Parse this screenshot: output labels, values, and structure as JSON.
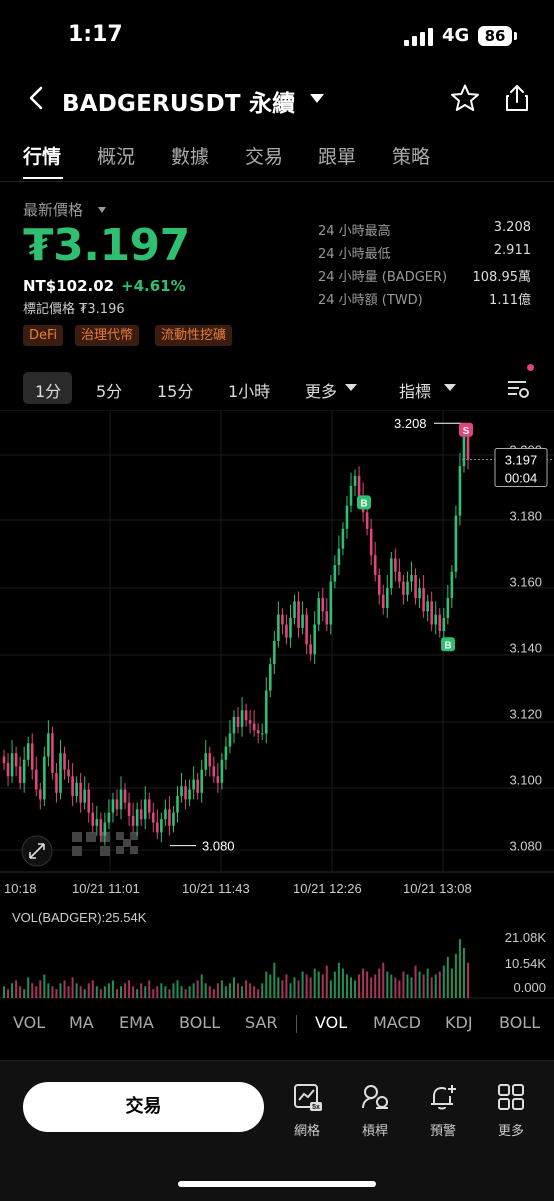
{
  "status_bar": {
    "time": "1:17",
    "network": "4G",
    "battery": "86"
  },
  "header": {
    "title": "BADGERUSDT 永續"
  },
  "tabs": [
    {
      "label": "行情",
      "active": true
    },
    {
      "label": "概況",
      "active": false
    },
    {
      "label": "數據",
      "active": false
    },
    {
      "label": "交易",
      "active": false
    },
    {
      "label": "跟單",
      "active": false
    },
    {
      "label": "策略",
      "active": false
    }
  ],
  "price": {
    "label": "最新價格",
    "last": "₮3.197",
    "fiat": "NT$102.02",
    "change": "+4.61%",
    "mark": "標記價格 ₮3.196"
  },
  "tags": [
    "DeFi",
    "治理代幣",
    "流動性挖礦"
  ],
  "stats": [
    {
      "label": "24 小時最高",
      "value": "3.208"
    },
    {
      "label": "24 小時最低",
      "value": "2.911"
    },
    {
      "label": "24 小時量 (BADGER)",
      "value": "108.95萬"
    },
    {
      "label": "24 小時額 (TWD)",
      "value": "1.11億"
    }
  ],
  "intervals": [
    "1分",
    "5分",
    "15分",
    "1小時",
    "更多",
    "指標"
  ],
  "colors": {
    "up": "#2fbf71",
    "down": "#e0457b",
    "accent_tag_bg": "#3a1d10",
    "accent_tag_fg": "#e87c3e"
  },
  "chart_data": {
    "type": "candlestick",
    "y_ticks": [
      "3.200",
      "3.180",
      "3.160",
      "3.140",
      "3.120",
      "3.100",
      "3.080"
    ],
    "ylim": [
      3.072,
      3.212
    ],
    "x_ticks": [
      "10:18",
      "10/21 11:01",
      "10/21 11:43",
      "10/21 12:26",
      "10/21 13:08"
    ],
    "high_label": "3.208",
    "low_label": "3.080",
    "current_price": "3.197",
    "countdown": "00:04",
    "markers": [
      {
        "label": "B",
        "color": "#2fbf71"
      },
      {
        "label": "B",
        "color": "#2fbf71"
      },
      {
        "label": "S",
        "color": "#e0457b"
      }
    ],
    "closes": [
      3.105,
      3.101,
      3.108,
      3.104,
      3.099,
      3.106,
      3.111,
      3.103,
      3.097,
      3.094,
      3.107,
      3.114,
      3.102,
      3.096,
      3.108,
      3.103,
      3.101,
      3.095,
      3.099,
      3.093,
      3.097,
      3.09,
      3.086,
      3.088,
      3.083,
      3.087,
      3.09,
      3.094,
      3.091,
      3.097,
      3.093,
      3.089,
      3.086,
      3.091,
      3.088,
      3.094,
      3.09,
      3.087,
      3.084,
      3.088,
      3.091,
      3.086,
      3.09,
      3.095,
      3.098,
      3.094,
      3.097,
      3.1,
      3.096,
      3.103,
      3.108,
      3.104,
      3.101,
      3.099,
      3.106,
      3.11,
      3.114,
      3.119,
      3.116,
      3.121,
      3.118,
      3.117,
      3.115,
      3.114,
      3.114,
      3.127,
      3.135,
      3.142,
      3.15,
      3.147,
      3.143,
      3.149,
      3.154,
      3.146,
      3.15,
      3.141,
      3.138,
      3.147,
      3.155,
      3.151,
      3.147,
      3.16,
      3.165,
      3.17,
      3.176,
      3.183,
      3.189,
      3.192,
      3.186,
      3.181,
      3.176,
      3.168,
      3.162,
      3.156,
      3.152,
      3.158,
      3.167,
      3.163,
      3.16,
      3.156,
      3.16,
      3.162,
      3.155,
      3.158,
      3.151,
      3.154,
      3.147,
      3.15,
      3.145,
      3.149,
      3.155,
      3.163,
      3.18,
      3.195,
      3.205,
      3.197
    ],
    "vol_label": "VOL(BADGER):25.54K",
    "vol_ticks": [
      "21.08K",
      "10.54K",
      "0.000"
    ],
    "volumes": [
      4,
      3,
      5,
      6,
      4,
      3,
      7,
      5,
      4,
      6,
      8,
      5,
      4,
      3,
      5,
      6,
      4,
      7,
      5,
      4,
      3,
      5,
      6,
      4,
      3,
      4,
      5,
      6,
      3,
      4,
      5,
      6,
      4,
      3,
      5,
      4,
      6,
      3,
      4,
      5,
      4,
      3,
      5,
      6,
      4,
      3,
      4,
      5,
      6,
      8,
      5,
      4,
      3,
      5,
      6,
      4,
      5,
      7,
      5,
      4,
      6,
      5,
      4,
      3,
      5,
      9,
      8,
      12,
      7,
      6,
      8,
      5,
      7,
      6,
      9,
      8,
      7,
      10,
      9,
      8,
      11,
      6,
      9,
      12,
      10,
      8,
      7,
      6,
      8,
      10,
      9,
      7,
      8,
      10,
      12,
      9,
      8,
      7,
      6,
      9,
      8,
      7,
      11,
      9,
      8,
      10,
      7,
      8,
      9,
      11,
      14,
      10,
      15,
      20,
      17,
      12
    ]
  },
  "indicators": [
    {
      "label": "VOL",
      "active": false
    },
    {
      "label": "MA",
      "active": false
    },
    {
      "label": "EMA",
      "active": false
    },
    {
      "label": "BOLL",
      "active": false
    },
    {
      "label": "SAR",
      "active": false
    },
    {
      "label": "VOL",
      "active": true
    },
    {
      "label": "MACD",
      "active": false
    },
    {
      "label": "KDJ",
      "active": false
    },
    {
      "label": "BOLL",
      "active": false
    }
  ],
  "dock": {
    "trade_label": "交易",
    "items": [
      {
        "label": "網格",
        "icon": "grid-bot-icon"
      },
      {
        "label": "槓桿",
        "icon": "leverage-icon"
      },
      {
        "label": "預警",
        "icon": "alert-bell-icon"
      },
      {
        "label": "更多",
        "icon": "more-grid-icon"
      }
    ]
  }
}
